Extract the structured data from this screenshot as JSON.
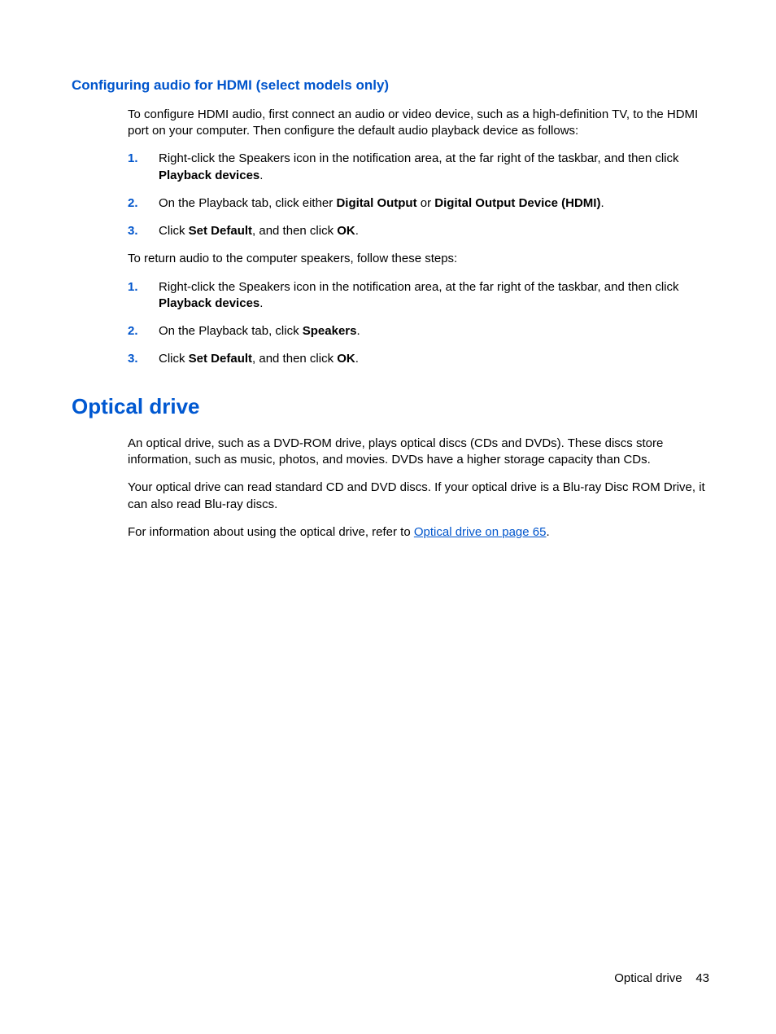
{
  "subheading": "Configuring audio for HDMI (select models only)",
  "intro": "To configure HDMI audio, first connect an audio or video device, such as a high-definition TV, to the HDMI port on your computer. Then configure the default audio playback device as follows:",
  "steps_a": [
    {
      "num": "1.",
      "pre": "Right-click the Speakers icon in the notification area, at the far right of the taskbar, and then click ",
      "bold": "Playback devices",
      "post": "."
    },
    {
      "num": "2.",
      "pre": "On the Playback tab, click either ",
      "bold": "Digital Output",
      "mid": " or ",
      "bold2": "Digital Output Device (HDMI)",
      "post": "."
    },
    {
      "num": "3.",
      "pre": "Click ",
      "bold": "Set Default",
      "mid": ", and then click ",
      "bold2": "OK",
      "post": "."
    }
  ],
  "return_intro": "To return audio to the computer speakers, follow these steps:",
  "steps_b": [
    {
      "num": "1.",
      "pre": "Right-click the Speakers icon in the notification area, at the far right of the taskbar, and then click ",
      "bold": "Playback devices",
      "post": "."
    },
    {
      "num": "2.",
      "pre": "On the Playback tab, click ",
      "bold": "Speakers",
      "post": "."
    },
    {
      "num": "3.",
      "pre": "Click ",
      "bold": "Set Default",
      "mid": ", and then click ",
      "bold2": "OK",
      "post": "."
    }
  ],
  "chapter": "Optical drive",
  "optical_p1": "An optical drive, such as a DVD-ROM drive, plays optical discs (CDs and DVDs). These discs store information, such as music, photos, and movies. DVDs have a higher storage capacity than CDs.",
  "optical_p2": "Your optical drive can read standard CD and DVD discs. If your optical drive is a Blu-ray Disc ROM Drive, it can also read Blu-ray discs.",
  "optical_p3_pre": "For information about using the optical drive, refer to ",
  "optical_p3_link": "Optical drive on page 65",
  "optical_p3_post": ".",
  "footer_label": "Optical drive",
  "footer_page": "43"
}
